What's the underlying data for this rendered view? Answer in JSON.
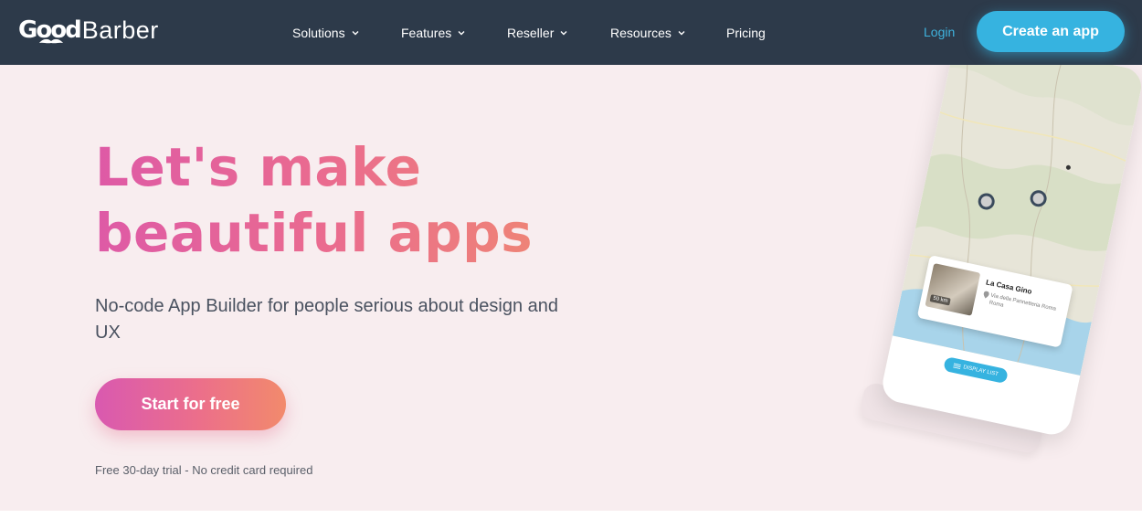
{
  "brand": {
    "logo_good": "Good",
    "logo_barber": "Barber"
  },
  "nav": {
    "items": [
      {
        "label": "Solutions",
        "has_dropdown": true
      },
      {
        "label": "Features",
        "has_dropdown": true
      },
      {
        "label": "Reseller",
        "has_dropdown": true
      },
      {
        "label": "Resources",
        "has_dropdown": true
      },
      {
        "label": "Pricing",
        "has_dropdown": false
      }
    ],
    "login_label": "Login",
    "create_app_label": "Create an app"
  },
  "hero": {
    "title_line1": "Let's make",
    "title_line2": "beautiful apps",
    "subtitle": "No-code App Builder for people serious about design and UX",
    "cta_label": "Start for free",
    "trial_note": "Free 30-day trial - No credit card required"
  },
  "phone": {
    "card_title": "La Casa Gino",
    "card_address": "Via della Pannetteria Roma Roma",
    "card_distance": "50 km",
    "display_list_label": "DISPLAY LIST"
  },
  "colors": {
    "header_bg": "#2d3a4a",
    "hero_bg": "#f8edef",
    "accent_blue": "#36b3e0",
    "gradient_start": "#de5aa6",
    "gradient_end": "#f08c6e"
  },
  "icons": [
    "chevron-down-icon",
    "map-pin-icon",
    "list-icon",
    "mustache-logo-icon"
  ]
}
